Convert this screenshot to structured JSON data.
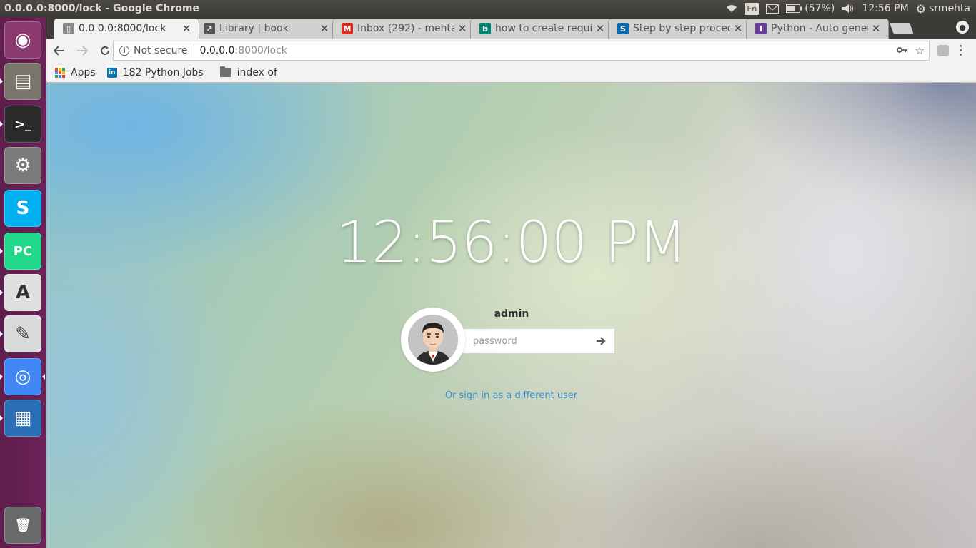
{
  "top_panel": {
    "window_title": "0.0.0.0:8000/lock - Google Chrome",
    "keyboard_layout": "En",
    "battery": "(57%)",
    "time": "12:56 PM",
    "user": "srmehta",
    "icons": [
      "wifi-icon",
      "keyboard-layout-badge",
      "mail-icon",
      "battery-icon",
      "volume-icon",
      "settings-gear-icon"
    ]
  },
  "launcher": {
    "items": [
      {
        "name": "ubuntu-dash-icon",
        "glyph": "◉",
        "bg": "#8a3a6e"
      },
      {
        "name": "files-icon",
        "glyph": "▤",
        "bg": "#7a756b"
      },
      {
        "name": "terminal-icon",
        "glyph": ">_",
        "bg": "#2b2b2b"
      },
      {
        "name": "system-settings-icon",
        "glyph": "⚙",
        "bg": "#7a7a7a"
      },
      {
        "name": "skype-icon",
        "glyph": "S",
        "bg": "#00aff0"
      },
      {
        "name": "pycharm-icon",
        "glyph": "PC",
        "bg": "#21d789"
      },
      {
        "name": "software-updater-icon",
        "glyph": "A",
        "bg": "#e0e0e0"
      },
      {
        "name": "text-editor-icon",
        "glyph": "✎",
        "bg": "#d9d9d9"
      },
      {
        "name": "chrome-icon",
        "glyph": "◎",
        "bg": "#4285f4"
      },
      {
        "name": "libreoffice-writer-icon",
        "glyph": "▦",
        "bg": "#2a6fb6"
      },
      {
        "name": "trash-icon",
        "glyph": "🗑",
        "bg": "#6a6a6a"
      }
    ]
  },
  "tabs": [
    {
      "title": "0.0.0.0:8000/lock",
      "icon": "page-icon",
      "icon_color": "#888888",
      "icon_glyph": "▯"
    },
    {
      "title": "Library | book",
      "icon": "library-tab-icon",
      "icon_color": "#555555",
      "icon_glyph": "↗"
    },
    {
      "title": "Inbox (292) - mehta",
      "icon": "gmail-icon",
      "icon_color": "#d93025",
      "icon_glyph": "M"
    },
    {
      "title": "how to create requi",
      "icon": "bing-icon",
      "icon_color": "#008373",
      "icon_glyph": "b"
    },
    {
      "title": "Step by step proced",
      "icon": "sharepoint-icon",
      "icon_color": "#0b6ab0",
      "icon_glyph": "S"
    },
    {
      "title": "Python - Auto gener",
      "icon": "site-icon",
      "icon_color": "#6b3fa0",
      "icon_glyph": "I"
    }
  ],
  "omnibox": {
    "security": "Not secure",
    "url_host": "0.0.0.0",
    "url_rest": ":8000/lock"
  },
  "bookmarks": [
    {
      "label": "Apps",
      "icon": "apps-grid-icon"
    },
    {
      "label": "182 Python Jobs",
      "icon": "linkedin-icon"
    },
    {
      "label": "index of",
      "icon": "folder-icon"
    }
  ],
  "lock_screen": {
    "clock": "12:56:00 PM",
    "username": "admin",
    "password_placeholder": "password",
    "alt_signin": "Or sign in as a different user"
  },
  "colors": {
    "link": "#3a8fd0",
    "launcher_bg": "#6c2259",
    "panel_bg": "#3c3b37"
  }
}
